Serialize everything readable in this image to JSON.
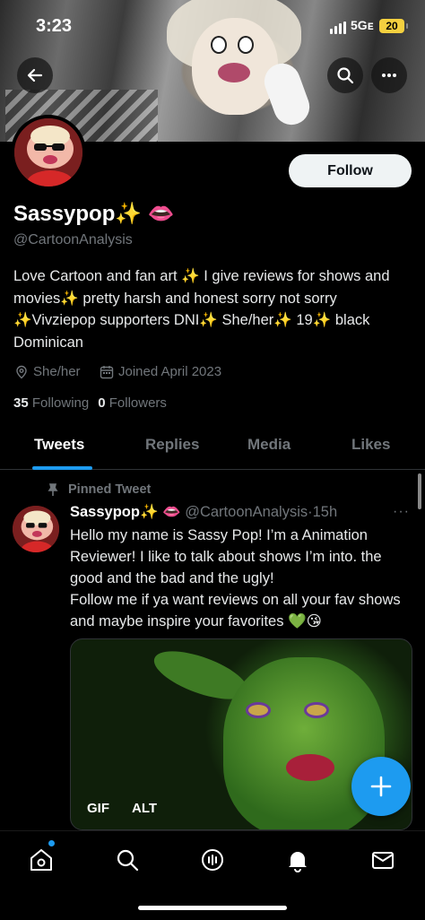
{
  "status_bar": {
    "time": "3:23",
    "network": "5Gᴇ",
    "battery": "20"
  },
  "header": {
    "back_icon": "arrow-left-icon",
    "search_icon": "search-icon",
    "more_icon": "more-horizontal-icon"
  },
  "profile": {
    "follow_label": "Follow",
    "display_name": "Sassypop✨ 👄",
    "handle": "@CartoonAnalysis",
    "bio": "Love Cartoon and fan art ✨ I give reviews for shows and movies✨ pretty harsh and honest sorry not sorry ✨Vivziepop supporters DNI✨ She/her✨ 19✨ black Dominican",
    "pronouns": "She/her",
    "joined": "Joined April 2023",
    "following_count": "35",
    "following_label": "Following",
    "followers_count": "0",
    "followers_label": "Followers"
  },
  "tabs": [
    {
      "label": "Tweets",
      "active": true
    },
    {
      "label": "Replies",
      "active": false
    },
    {
      "label": "Media",
      "active": false
    },
    {
      "label": "Likes",
      "active": false
    }
  ],
  "tweet": {
    "pinned_label": "Pinned Tweet",
    "author_name": "Sassypop✨ 👄",
    "author_handle": "@CartoonAnalysis",
    "separator": "·",
    "time": "15h",
    "more": "···",
    "text": "Hello my name is Sassy Pop! I’m a Animation Reviewer! I like to talk about shows I’m into. the good and the bad and the ugly!\nFollow me if ya want reviews on all your fav shows and maybe inspire your favorites 💚😘",
    "media_badges": [
      "GIF",
      "ALT"
    ]
  },
  "fab": {
    "icon": "plus-icon",
    "color": "#1d9bf0"
  },
  "bottom_nav": [
    {
      "icon": "home-icon",
      "has_notification_dot": true
    },
    {
      "icon": "search-icon"
    },
    {
      "icon": "spaces-icon"
    },
    {
      "icon": "bell-icon"
    },
    {
      "icon": "mail-icon"
    }
  ],
  "colors": {
    "accent": "#1d9bf0",
    "background": "#000000",
    "secondary_text": "#71767b"
  }
}
